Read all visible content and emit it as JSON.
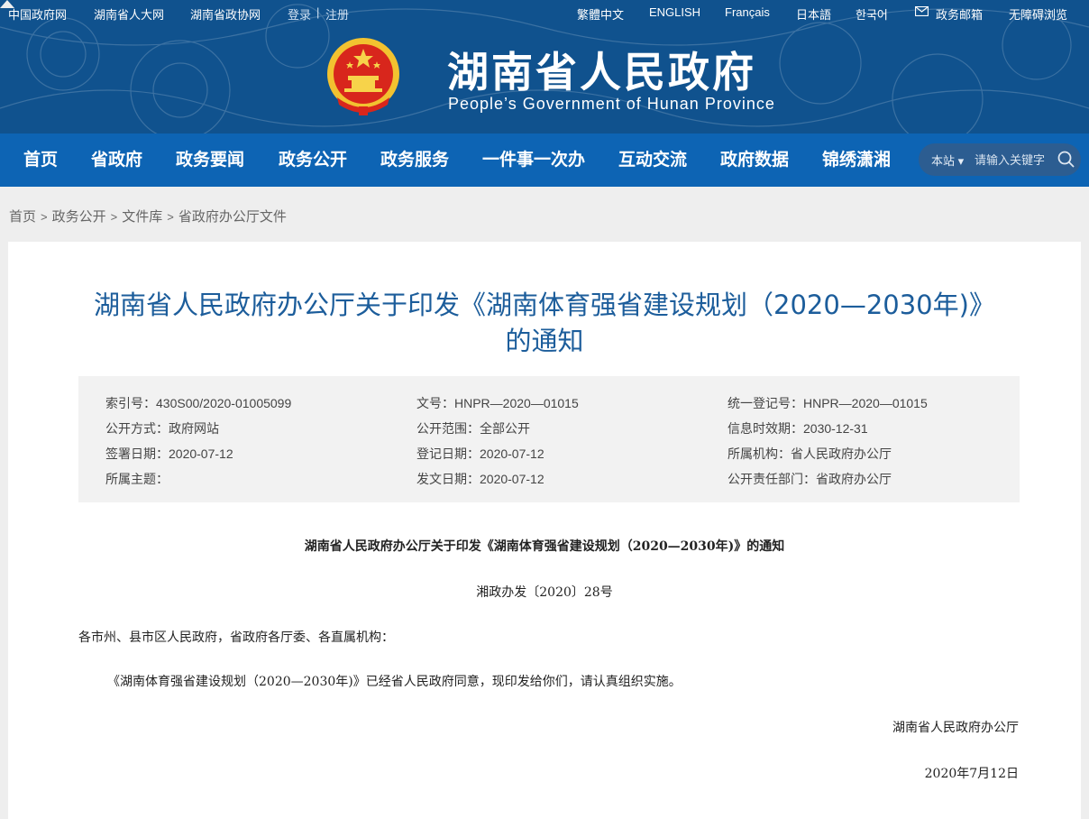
{
  "topbar": {
    "left_links": [
      "中国政府网",
      "湖南省人大网",
      "湖南省政协网"
    ],
    "login": "登录",
    "divider": "|",
    "register": "注册",
    "right_links": [
      "繁體中文",
      "ENGLISH",
      "Français",
      "日本語",
      "한국어"
    ],
    "mail_label": "政务邮箱",
    "accessible_label": "无障碍浏览"
  },
  "header": {
    "title": "湖南省人民政府",
    "subtitle": "People’s Government of Hunan Province"
  },
  "nav": {
    "items": [
      "首页",
      "省政府",
      "政务要闻",
      "政务公开",
      "政务服务",
      "一件事一次办",
      "互动交流",
      "政府数据",
      "锦绣潇湘"
    ],
    "active_index": 3,
    "search_scope": "本站",
    "search_placeholder": "请输入关键字"
  },
  "breadcrumb": [
    "首页",
    "政务公开",
    "文件库",
    "省政府办公厅文件"
  ],
  "breadcrumb_sep": ">",
  "document": {
    "title_line1": "湖南省人民政府办公厅关于印发《湖南体育强省建设规划（2020—2030年)》",
    "title_line2": "的通知",
    "meta": {
      "r1c1": "索引号：430S00/2020-01005099",
      "r1c2": "文号：HNPR—2020—01015",
      "r1c3": "统一登记号：HNPR—2020—01015",
      "r2c1": "公开方式：政府网站",
      "r2c2": "公开范围：全部公开",
      "r2c3": "信息时效期：2030-12-31",
      "r3c1": "签署日期：2020-07-12",
      "r3c2": "登记日期：2020-07-12",
      "r3c3": "所属机构：省人民政府办公厅",
      "r4c1": "所属主题：",
      "r4c2": "发文日期：2020-07-12",
      "r4c3": "公开责任部门：省政府办公厅"
    },
    "body_title": "湖南省人民政府办公厅关于印发《湖南体育强省建设规划（2020—2030年)》的通知",
    "doc_number": "湘政办发〔2020〕28号",
    "addressees": "各市州、县市区人民政府，省政府各厅委、各直属机构：",
    "paragraph": "《湖南体育强省建设规划（2020—2030年)》已经省人民政府同意，现印发给你们，请认真组织实施。",
    "signature": "湖南省人民政府办公厅",
    "date": "2020年7月12日"
  },
  "colors": {
    "header_bg": "#10528e",
    "nav_bg": "#0d64b4",
    "title_blue": "#1c5d9b",
    "meta_bg": "#f2f2f2"
  }
}
